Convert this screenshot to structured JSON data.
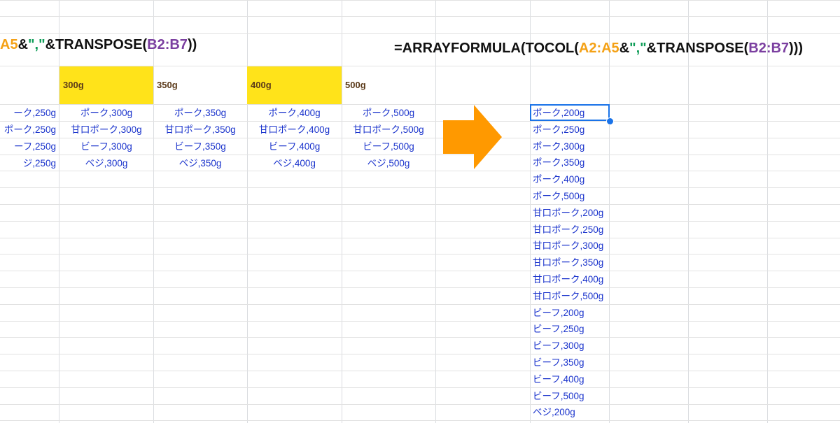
{
  "formulas": {
    "left": [
      {
        "text": "A5",
        "color": "orange"
      },
      {
        "text": "&",
        "color": "black"
      },
      {
        "text": "\",\"",
        "color": "green"
      },
      {
        "text": "&TRANSPOSE(",
        "color": "black"
      },
      {
        "text": "B2:B7",
        "color": "purple"
      },
      {
        "text": "))",
        "color": "black"
      }
    ],
    "right": [
      {
        "text": "=ARRAYFORMULA(TOCOL(",
        "color": "black"
      },
      {
        "text": "A2:A5",
        "color": "orange"
      },
      {
        "text": "&",
        "color": "black"
      },
      {
        "text": "\",\"",
        "color": "green"
      },
      {
        "text": "&TRANSPOSE(",
        "color": "black"
      },
      {
        "text": "B2:B7",
        "color": "purple"
      },
      {
        "text": ")))",
        "color": "black"
      }
    ]
  },
  "colors": {
    "header_yellow": "#ffe31a",
    "cell_text_blue": "#1a33cc",
    "arrow_orange": "#ff9900",
    "selection_blue": "#1a73e8"
  },
  "headers": [
    "300g",
    "350g",
    "400g",
    "500g"
  ],
  "grid": {
    "rows": [
      [
        "ーク,250g",
        "ポーク,300g",
        "ポーク,350g",
        "ポーク,400g",
        "ポーク,500g"
      ],
      [
        "ポーク,250g",
        "甘口ポーク,300g",
        "甘口ポーク,350g",
        "甘口ポーク,400g",
        "甘口ポーク,500g"
      ],
      [
        "ーフ,250g",
        "ビーフ,300g",
        "ビーフ,350g",
        "ビーフ,400g",
        "ビーフ,500g"
      ],
      [
        "ジ,250g",
        "ベジ,300g",
        "ベジ,350g",
        "ベジ,400g",
        "ベジ,500g"
      ]
    ]
  },
  "arrow_icon": "right-arrow-icon",
  "result_list": [
    "ポーク,200g",
    "ポーク,250g",
    "ポーク,300g",
    "ポーク,350g",
    "ポーク,400g",
    "ポーク,500g",
    "甘口ポーク,200g",
    "甘口ポーク,250g",
    "甘口ポーク,300g",
    "甘口ポーク,350g",
    "甘口ポーク,400g",
    "甘口ポーク,500g",
    "ビーフ,200g",
    "ビーフ,250g",
    "ビーフ,300g",
    "ビーフ,350g",
    "ビーフ,400g",
    "ビーフ,500g",
    "ベジ,200g"
  ]
}
